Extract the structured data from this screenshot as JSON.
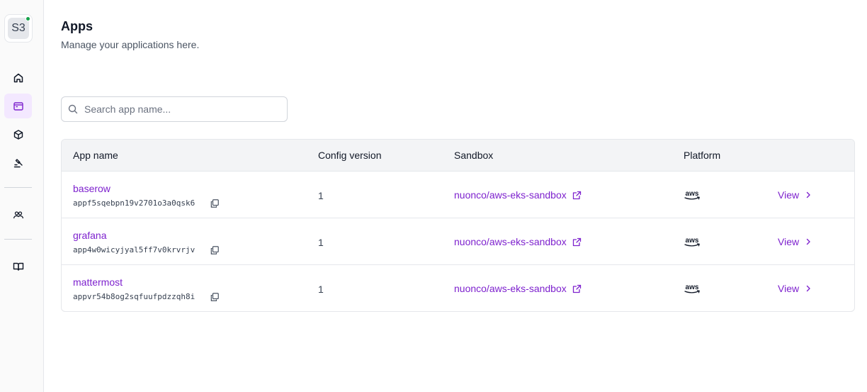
{
  "org": {
    "avatar_text": "S3",
    "status_color": "#16a34a"
  },
  "sidebar": {
    "items": [
      {
        "icon": "home-icon",
        "active": false
      },
      {
        "icon": "apps-icon",
        "active": true
      },
      {
        "icon": "box-icon",
        "active": false
      },
      {
        "icon": "hammer-icon",
        "active": false
      },
      {
        "icon": "team-icon",
        "active": false
      },
      {
        "icon": "book-icon",
        "active": false
      }
    ]
  },
  "page": {
    "title": "Apps",
    "subtitle": "Manage your applications here."
  },
  "search": {
    "placeholder": "Search app name...",
    "value": ""
  },
  "table": {
    "headers": [
      "App name",
      "Config version",
      "Sandbox",
      "Platform"
    ],
    "rows": [
      {
        "name": "baserow",
        "id": "appf5sqebpn19v2701o3a0qsk6",
        "config_version": "1",
        "sandbox": "nuonco/aws-eks-sandbox",
        "platform": "aws",
        "action": "View"
      },
      {
        "name": "grafana",
        "id": "app4w0wicyjyal5ff7v0krvrjv",
        "config_version": "1",
        "sandbox": "nuonco/aws-eks-sandbox",
        "platform": "aws",
        "action": "View"
      },
      {
        "name": "mattermost",
        "id": "appvr54b8og2sqfuufpdzzqh8i",
        "config_version": "1",
        "sandbox": "nuonco/aws-eks-sandbox",
        "platform": "aws",
        "action": "View"
      }
    ]
  },
  "colors": {
    "accent": "#7e22ce",
    "active_nav_bg": "#f3e8ff",
    "header_bg": "#f3f4f6"
  }
}
